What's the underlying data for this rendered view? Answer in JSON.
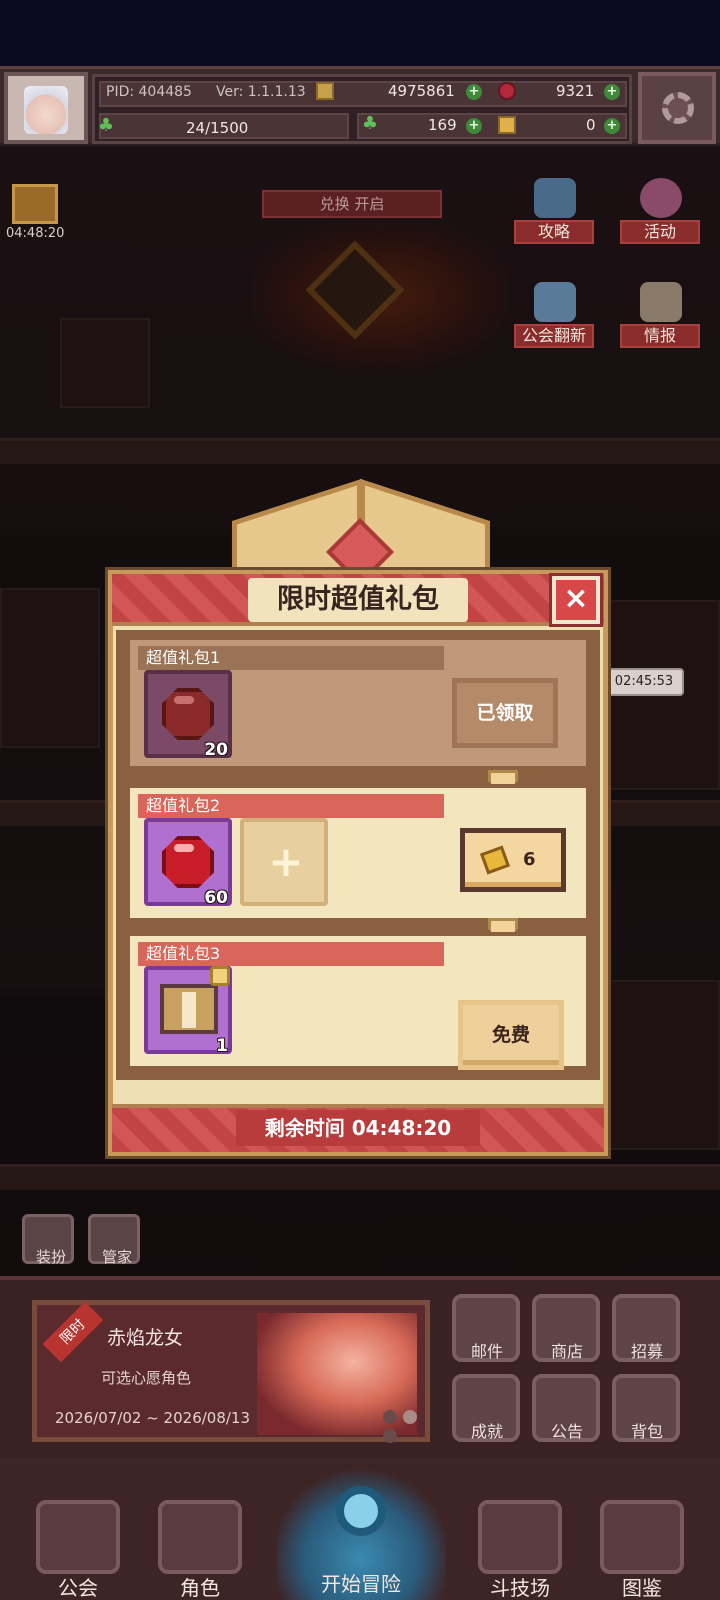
{
  "topbar": {
    "pid": "PID: 404485",
    "version": "Ver: 1.1.1.13",
    "gold": "4975861",
    "gems": "9321",
    "stamina": "24/1500",
    "clover": "169",
    "tickets": "0"
  },
  "side": {
    "gift_timer": "04:48:20",
    "guide_label": "攻略",
    "activity_label": "活动",
    "guild_refresh_label": "公会翻新",
    "intel_label": "情报",
    "banner_text": "兑换   开启",
    "bubble_timer": "02:45:53"
  },
  "modal": {
    "title": "限时超值礼包",
    "close_icon": "×",
    "packs": [
      {
        "name": "超值礼包1",
        "qty": "20",
        "button": "已领取"
      },
      {
        "name": "超值礼包2",
        "qty": "60",
        "plus": "+",
        "price": "6"
      },
      {
        "name": "超值礼包3",
        "qty": "1",
        "button": "免费"
      }
    ],
    "footer": "剩余时间 04:48:20"
  },
  "bottom": {
    "dress_label": "装扮",
    "butler_label": "管家",
    "event": {
      "tag": "限时",
      "title": "赤焰龙女",
      "subtitle": "可选心愿角色",
      "date": "2026/07/02 ~ 2026/08/13"
    },
    "grid": [
      "邮件",
      "商店",
      "招募",
      "成就",
      "公告",
      "背包"
    ],
    "nav": [
      "公会",
      "角色",
      "开始冒险",
      "斗技场",
      "图鉴"
    ]
  },
  "colors": {
    "accent_red": "#c24444",
    "panel_cream": "#efe0b4",
    "frame_gold": "#c79a5c"
  }
}
